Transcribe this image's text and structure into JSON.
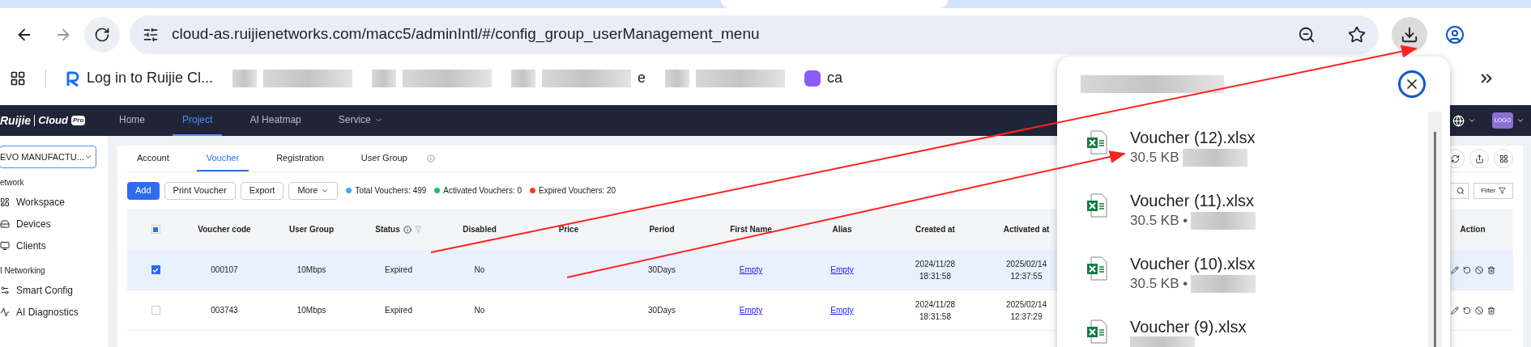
{
  "browser": {
    "url": "cloud-as.ruijienetworks.com/macc5/adminIntl/#/config_group_userManagement_menu",
    "bookmarks": [
      {
        "kind": "ruijie",
        "label": "Log in to Ruijie Cl..."
      },
      {
        "kind": "blurred"
      },
      {
        "kind": "blurred"
      },
      {
        "kind": "blurred",
        "label": "e"
      },
      {
        "kind": "blurred"
      },
      {
        "kind": "purple",
        "label": "ca"
      }
    ]
  },
  "app": {
    "logo": {
      "brand": "Ruijie",
      "product": "Cloud",
      "badge": "Pro"
    },
    "nav": [
      {
        "label": "Home",
        "selected": false,
        "has_menu": false
      },
      {
        "label": "Project",
        "selected": true,
        "has_menu": false
      },
      {
        "label": "AI Heatmap",
        "selected": false,
        "has_menu": false
      },
      {
        "label": "Service",
        "selected": false,
        "has_menu": true
      }
    ],
    "avatar": "LOGO",
    "project_select": "EVO MANUFACTU...",
    "sidebar": [
      {
        "title": "etwork",
        "items": [
          {
            "label": "Workspace",
            "kind": "workspace"
          },
          {
            "label": "Devices",
            "kind": "devices"
          },
          {
            "label": "Clients",
            "kind": "clients"
          }
        ]
      },
      {
        "title": "I Networking",
        "items": [
          {
            "label": "Smart Config",
            "kind": "config"
          },
          {
            "label": "AI Diagnostics",
            "kind": "diagnostics"
          }
        ]
      }
    ],
    "tabs": [
      {
        "label": "Account",
        "selected": false
      },
      {
        "label": "Voucher",
        "selected": true
      },
      {
        "label": "Registration",
        "selected": false
      },
      {
        "label": "User Group",
        "selected": false
      }
    ],
    "buttons": [
      {
        "label": "Add",
        "kind": "primary"
      },
      {
        "label": "Print Voucher",
        "kind": "default"
      },
      {
        "label": "Export",
        "kind": "default"
      },
      {
        "label": "More",
        "kind": "menu"
      }
    ],
    "stats": [
      {
        "label": "Total Vouchers: 499",
        "color": "#4aa8f7"
      },
      {
        "label": "Activated Vouchers: 0",
        "color": "#1ec25e"
      },
      {
        "label": "Expired Vouchers: 20",
        "color": "#f5401a"
      }
    ],
    "filter_button": "Filter",
    "table": {
      "indeterminate": true,
      "columns": [
        "Voucher code",
        "User Group",
        "Status",
        "Disabled",
        "Price",
        "Period",
        "First Name",
        "Alias",
        "Created at",
        "Activated at",
        "Action"
      ],
      "rows": [
        {
          "selected": true,
          "code": "000107",
          "group": "10Mbps",
          "status": "Expired",
          "disabled": "No",
          "period": "30Days",
          "first_name": "Empty",
          "alias": "Empty",
          "created": [
            "2024/11/28",
            "18:31:58"
          ],
          "activated": [
            "2025/02/14",
            "12:37:55"
          ]
        },
        {
          "selected": false,
          "code": "003743",
          "group": "10Mbps",
          "status": "Expired",
          "disabled": "No",
          "period": "30Days",
          "first_name": "Empty",
          "alias": "Empty",
          "created": [
            "2024/11/28",
            "18:31:58"
          ],
          "activated": [
            "2025/02/14",
            "12:37:29"
          ]
        }
      ]
    }
  },
  "downloads": {
    "items": [
      {
        "name": "Voucher (12).xlsx",
        "size": "30.5 KB"
      },
      {
        "name": "Voucher (11).xlsx",
        "size": "30.5 KB •"
      },
      {
        "name": "Voucher (10).xlsx",
        "size": "30.5 KB •"
      },
      {
        "name": "Voucher (9).xlsx"
      }
    ]
  }
}
